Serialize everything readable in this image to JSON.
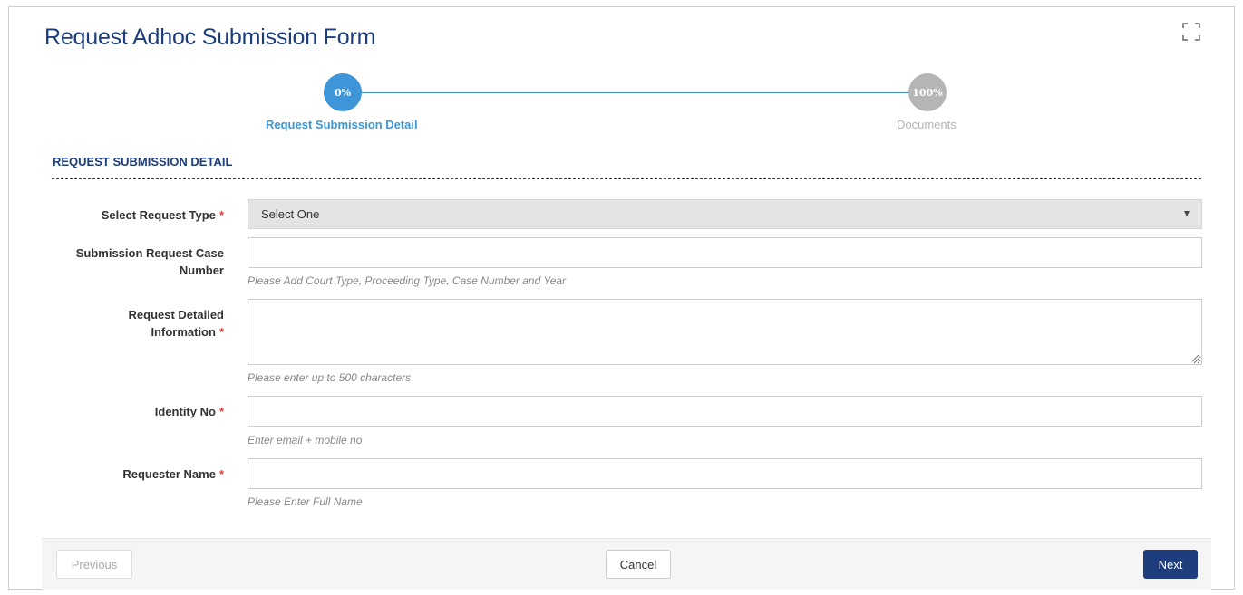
{
  "form": {
    "title": "Request Adhoc Submission Form"
  },
  "icons": {
    "expand": "expand-icon",
    "select_arrow": "chevron-down-icon",
    "resize_grip": "resize-grip-icon"
  },
  "stepper": {
    "progress_percent": 0,
    "steps": [
      {
        "percent_label": "0%",
        "label": "Request Submission Detail",
        "active": true
      },
      {
        "percent_label": "100%",
        "label": "Documents",
        "active": false
      }
    ]
  },
  "section": {
    "title": "REQUEST SUBMISSION DETAIL"
  },
  "fields": {
    "request_type": {
      "label": "Select Request Type",
      "required_mark": "*",
      "selected_value": "Select One"
    },
    "case_number": {
      "label_line1": "Submission Request Case",
      "label_line2": "Number",
      "value": "",
      "hint": "Please Add Court Type, Proceeding Type, Case Number and Year"
    },
    "detailed_info": {
      "label_line1": "Request Detailed",
      "label_line2": "Information",
      "required_mark": "*",
      "value": "",
      "hint": "Please enter up to 500 characters"
    },
    "identity_no": {
      "label": "Identity No",
      "required_mark": "*",
      "value": "",
      "hint": "Enter email + mobile no"
    },
    "requester_name": {
      "label": "Requester Name",
      "required_mark": "*",
      "value": "",
      "hint": "Please Enter Full Name"
    }
  },
  "footer": {
    "previous_label": "Previous",
    "cancel_label": "Cancel",
    "next_label": "Next"
  },
  "colors": {
    "brand_navy": "#1d3d7c",
    "step_active": "#3e96d8",
    "step_inactive": "#b5b5b5",
    "required": "#e23d3d"
  }
}
